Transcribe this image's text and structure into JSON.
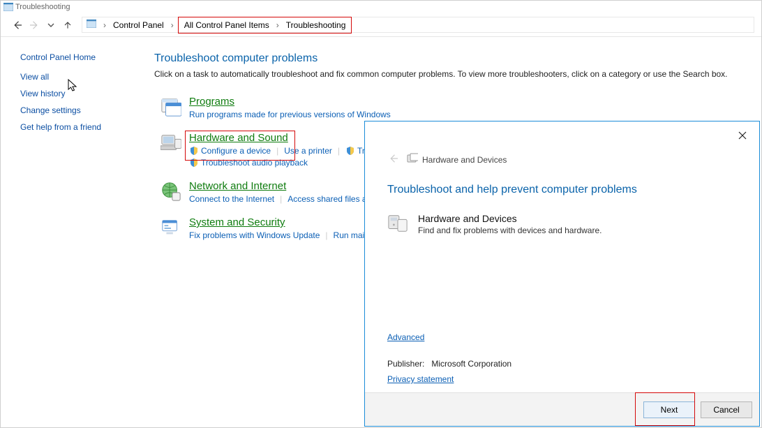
{
  "window": {
    "title": "Troubleshooting"
  },
  "breadcrumbs": {
    "root": "Control Panel",
    "mid": "All Control Panel Items",
    "leaf": "Troubleshooting"
  },
  "sidebar": {
    "home": "Control Panel Home",
    "links": [
      "View all",
      "View history",
      "Change settings",
      "Get help from a friend"
    ]
  },
  "page": {
    "title": "Troubleshoot computer problems",
    "desc": "Click on a task to automatically troubleshoot and fix common computer problems. To view more troubleshooters, click on a category or use the Search box."
  },
  "categories": {
    "programs": {
      "title": "Programs",
      "links": [
        "Run programs made for previous versions of Windows"
      ]
    },
    "hardware": {
      "title": "Hardware and Sound",
      "links": [
        "Configure a device",
        "Use a printer",
        "Troubleshoot audio recording"
      ],
      "row2": [
        "Troubleshoot audio playback"
      ]
    },
    "network": {
      "title": "Network and Internet",
      "links": [
        "Connect to the Internet",
        "Access shared files and folders on other computers"
      ]
    },
    "system": {
      "title": "System and Security",
      "links": [
        "Fix problems with Windows Update",
        "Run maintenance tasks"
      ]
    }
  },
  "dialog": {
    "header": "Hardware and Devices",
    "title": "Troubleshoot and help prevent computer problems",
    "item_title": "Hardware and Devices",
    "item_desc": "Find and fix problems with devices and hardware.",
    "advanced": "Advanced",
    "publisher_label": "Publisher:",
    "publisher_value": "Microsoft Corporation",
    "privacy": "Privacy statement",
    "next": "Next",
    "cancel": "Cancel"
  }
}
